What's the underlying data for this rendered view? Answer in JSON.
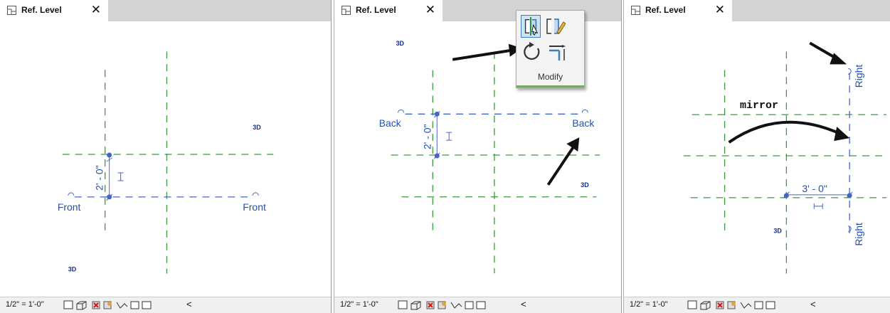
{
  "tab": {
    "title": "Ref. Level",
    "close": "✕"
  },
  "status": {
    "scale": "1/2\" = 1'-0\"",
    "chevron": "<"
  },
  "panel1": {
    "dimension": "2' - 0\"",
    "left_label": "Front",
    "right_label": "Front",
    "tag_a": "3D",
    "tag_b": "3D"
  },
  "panel2": {
    "dimension": "2' - 0\"",
    "left_label": "Back",
    "right_label": "Back",
    "tag_a": "3D",
    "tag_b": "3D",
    "toolbox": {
      "label": "Modify",
      "icons": [
        "mirror-pick-axis-icon",
        "mirror-draw-axis-icon",
        "rotate-icon",
        "trim-extend-icon"
      ]
    }
  },
  "panel3": {
    "dimension": "3' - 0\"",
    "top_label": "Right",
    "bottom_label": "Right",
    "tag": "3D",
    "annotation": "mirror"
  },
  "colors": {
    "grid": "#3b9b3b",
    "reference": "#4565c4",
    "label": "#1f4fb8",
    "tab_bar": "#d4d4d4"
  }
}
